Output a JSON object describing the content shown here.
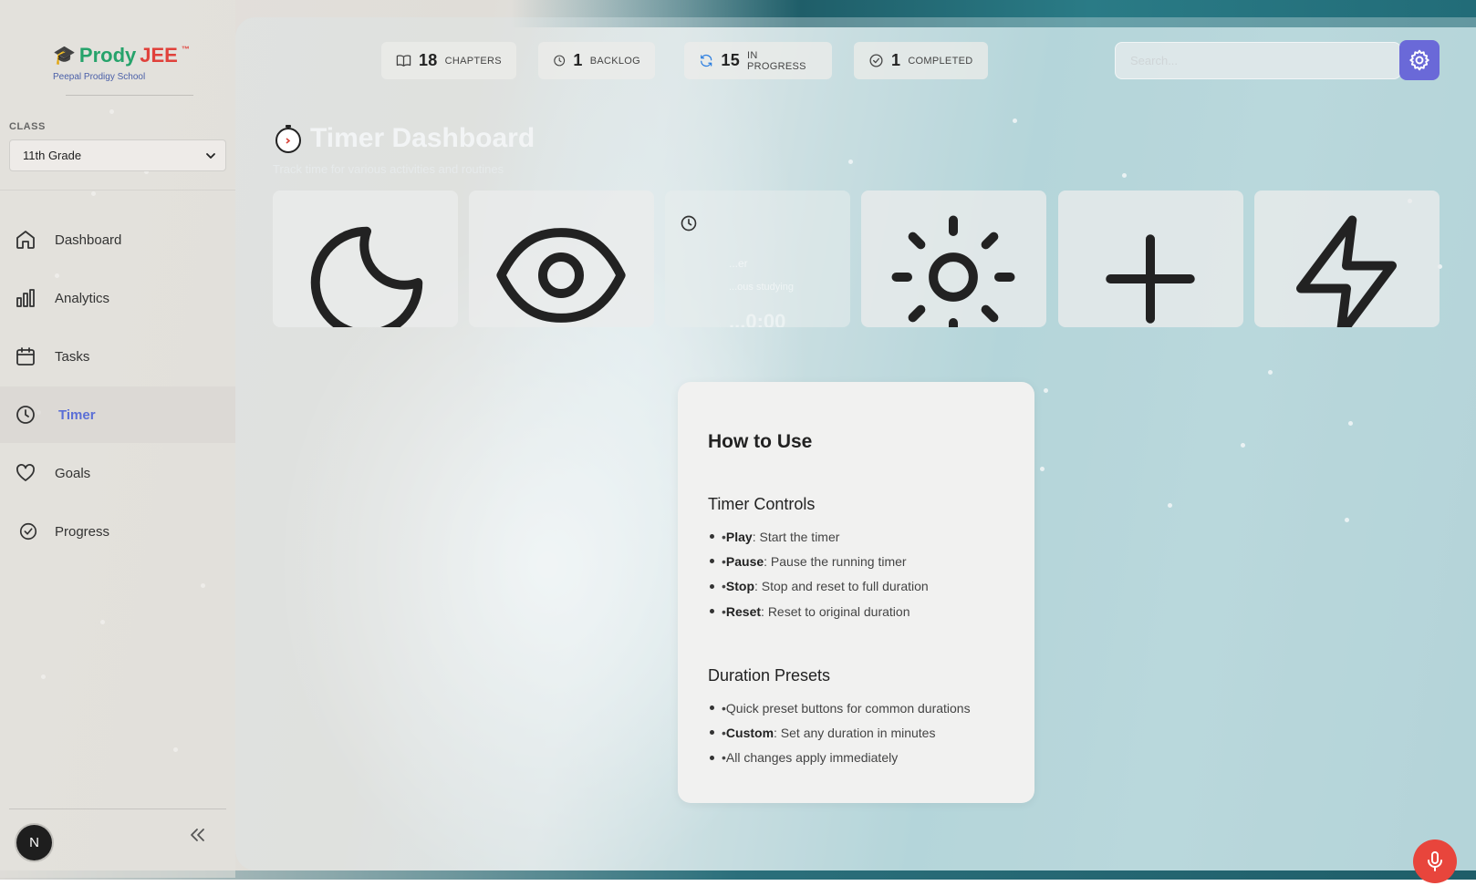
{
  "brand": {
    "cap": "🎓",
    "name_part1": "Prody",
    "name_part2": "JEE",
    "tm": "™",
    "school": "Peepal Prodigy School"
  },
  "class_selector": {
    "label": "CLASS",
    "value": "11th Grade"
  },
  "nav": [
    {
      "label": "Dashboard",
      "icon": "home-icon"
    },
    {
      "label": "Analytics",
      "icon": "bar-chart-icon"
    },
    {
      "label": "Tasks",
      "icon": "calendar-icon"
    },
    {
      "label": "Timer",
      "icon": "clock-icon",
      "active": true
    },
    {
      "label": "Goals",
      "icon": "heart-icon"
    },
    {
      "label": "Progress",
      "icon": "check-circle-icon"
    }
  ],
  "user": {
    "initial": "N"
  },
  "stats": [
    {
      "count": "18",
      "label": "CHAPTERS",
      "icon": "book-icon"
    },
    {
      "count": "1",
      "label": "BACKLOG",
      "icon": "clock-icon"
    },
    {
      "count": "15",
      "label": "IN PROGRESS",
      "icon": "refresh-icon"
    },
    {
      "count": "1",
      "label": "COMPLETED",
      "icon": "check-circle-icon"
    }
  ],
  "search": {
    "placeholder": "Search..."
  },
  "page": {
    "title": "Timer Dashboard",
    "subtitle": "Track time for various activities and routines"
  },
  "timer_cards": [
    {
      "icon": "moon-icon"
    },
    {
      "icon": "eye-icon"
    },
    {
      "icon": "clock-icon",
      "label": "...er",
      "sublabel": "...ous studying",
      "time": "...0:00"
    },
    {
      "icon": "sun-icon"
    },
    {
      "icon": "plus-icon"
    },
    {
      "icon": "lightning-icon"
    }
  ],
  "howto": {
    "title": "How to Use",
    "controls_heading": "Timer Controls",
    "controls": [
      {
        "prefix": "• ",
        "key": "Play",
        "text": ": Start the timer"
      },
      {
        "prefix": "• ",
        "key": "Pause",
        "text": ": Pause the running timer"
      },
      {
        "prefix": "• ",
        "key": "Stop",
        "text": ": Stop and reset to full duration"
      },
      {
        "prefix": "• ",
        "key": "Reset",
        "text": ": Reset to original duration"
      }
    ],
    "presets_heading": "Duration Presets",
    "presets": [
      {
        "prefix": "• ",
        "key": "",
        "text": "Quick preset buttons for common durations"
      },
      {
        "prefix": "• ",
        "key": "Custom",
        "text": ": Set any duration in minutes"
      },
      {
        "prefix": "• ",
        "key": "",
        "text": "All changes apply immediately"
      }
    ]
  },
  "colors": {
    "accent": "#5b6fd6",
    "settings_button": "#6a69d8",
    "mic_button": "#e8453c",
    "brand_green": "#26a36b",
    "brand_red": "#e0413b"
  }
}
